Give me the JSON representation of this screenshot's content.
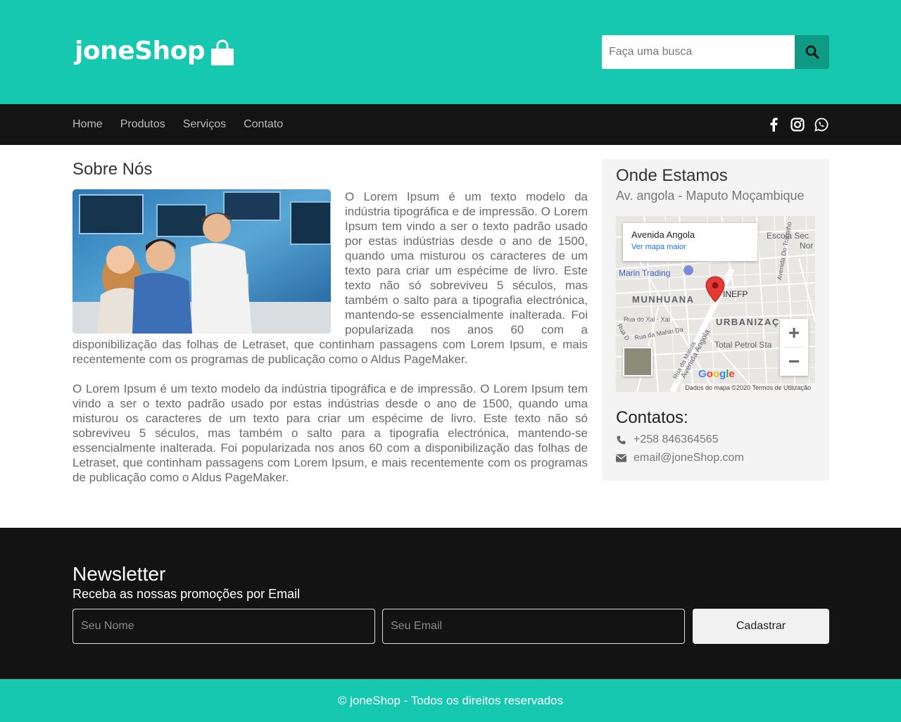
{
  "header": {
    "logo_text": "joneShop",
    "search": {
      "placeholder": "Faça uma busca"
    }
  },
  "nav": {
    "links": [
      "Home",
      "Produtos",
      "Serviços",
      "Contato"
    ],
    "social_icons": [
      "facebook-icon",
      "instagram-icon",
      "whatsapp-icon"
    ]
  },
  "about": {
    "title": "Sobre Nós",
    "paragraphs": [
      "O Lorem Ipsum é um texto modelo da indústria tipográfica e de impressão. O Lorem Ipsum tem vindo a ser o texto padrão usado por estas indústrias desde o ano de 1500, quando uma misturou os caracteres de um texto para criar um espécime de livro. Este texto não só sobreviveu 5 séculos, mas também o salto para a tipografia electrónica, mantendo-se essencialmente inalterada. Foi popularizada nos anos 60 com a disponibilização das folhas de Letraset, que continham passagens com Lorem Ipsum, e mais recentemente com os programas de publicação como o Aldus PageMaker.",
      "O Lorem Ipsum é um texto modelo da indústria tipográfica e de impressão. O Lorem Ipsum tem vindo a ser o texto padrão usado por estas indústrias desde o ano de 1500, quando uma misturou os caracteres de um texto para criar um espécime de livro. Este texto não só sobreviveu 5 séculos, mas também o salto para a tipografia electrónica, mantendo-se essencialmente inalterada. Foi popularizada nos anos 60 com a disponibilização das folhas de Letraset, que continham passagens com Lorem Ipsum, e mais recentemente com os programas de publicação como o Aldus PageMaker."
    ]
  },
  "location": {
    "title": "Onde Estamos",
    "address": "Av. angola - Maputo Moçambique",
    "map": {
      "place_name": "Avenida Angola",
      "larger_map_link": "Ver mapa maior",
      "labels": {
        "escola": "Escola Sec",
        "nor": "Nor",
        "marin": "Marin Trading",
        "inefp": "INEFP",
        "munhuana": "MUNHUANA",
        "urbanizac": "URBANIZAÇ",
        "rua_xai": "Rua do Xai - Xai",
        "rua_mahin": "Rua da Mahin Da",
        "rua_d": "Rua D",
        "av_angola": "Avenida Angola",
        "rua_matola": "Rua da Matola",
        "total": "Total Petrol Sta",
        "av_trabalho": "Avenida Do Trabalho"
      },
      "google": "Google",
      "footer": "Dados do mapa ©2020   Termos de Utilização",
      "zoom_in": "+",
      "zoom_out": "−"
    }
  },
  "contacts": {
    "title": "Contatos:",
    "phone": "+258 846364565",
    "email": "email@joneShop.com"
  },
  "newsletter": {
    "title": "Newsletter",
    "subtitle": "Receba as nossas promoções por Email",
    "name_placeholder": "Seu Nome",
    "email_placeholder": "Seu Email",
    "submit_label": "Cadastrar"
  },
  "footer": {
    "text": "© joneShop - Todos os direitos reservados"
  },
  "colors": {
    "brand": "#17c8b0",
    "brand_dark": "#0f9a86",
    "dark": "#141414"
  }
}
